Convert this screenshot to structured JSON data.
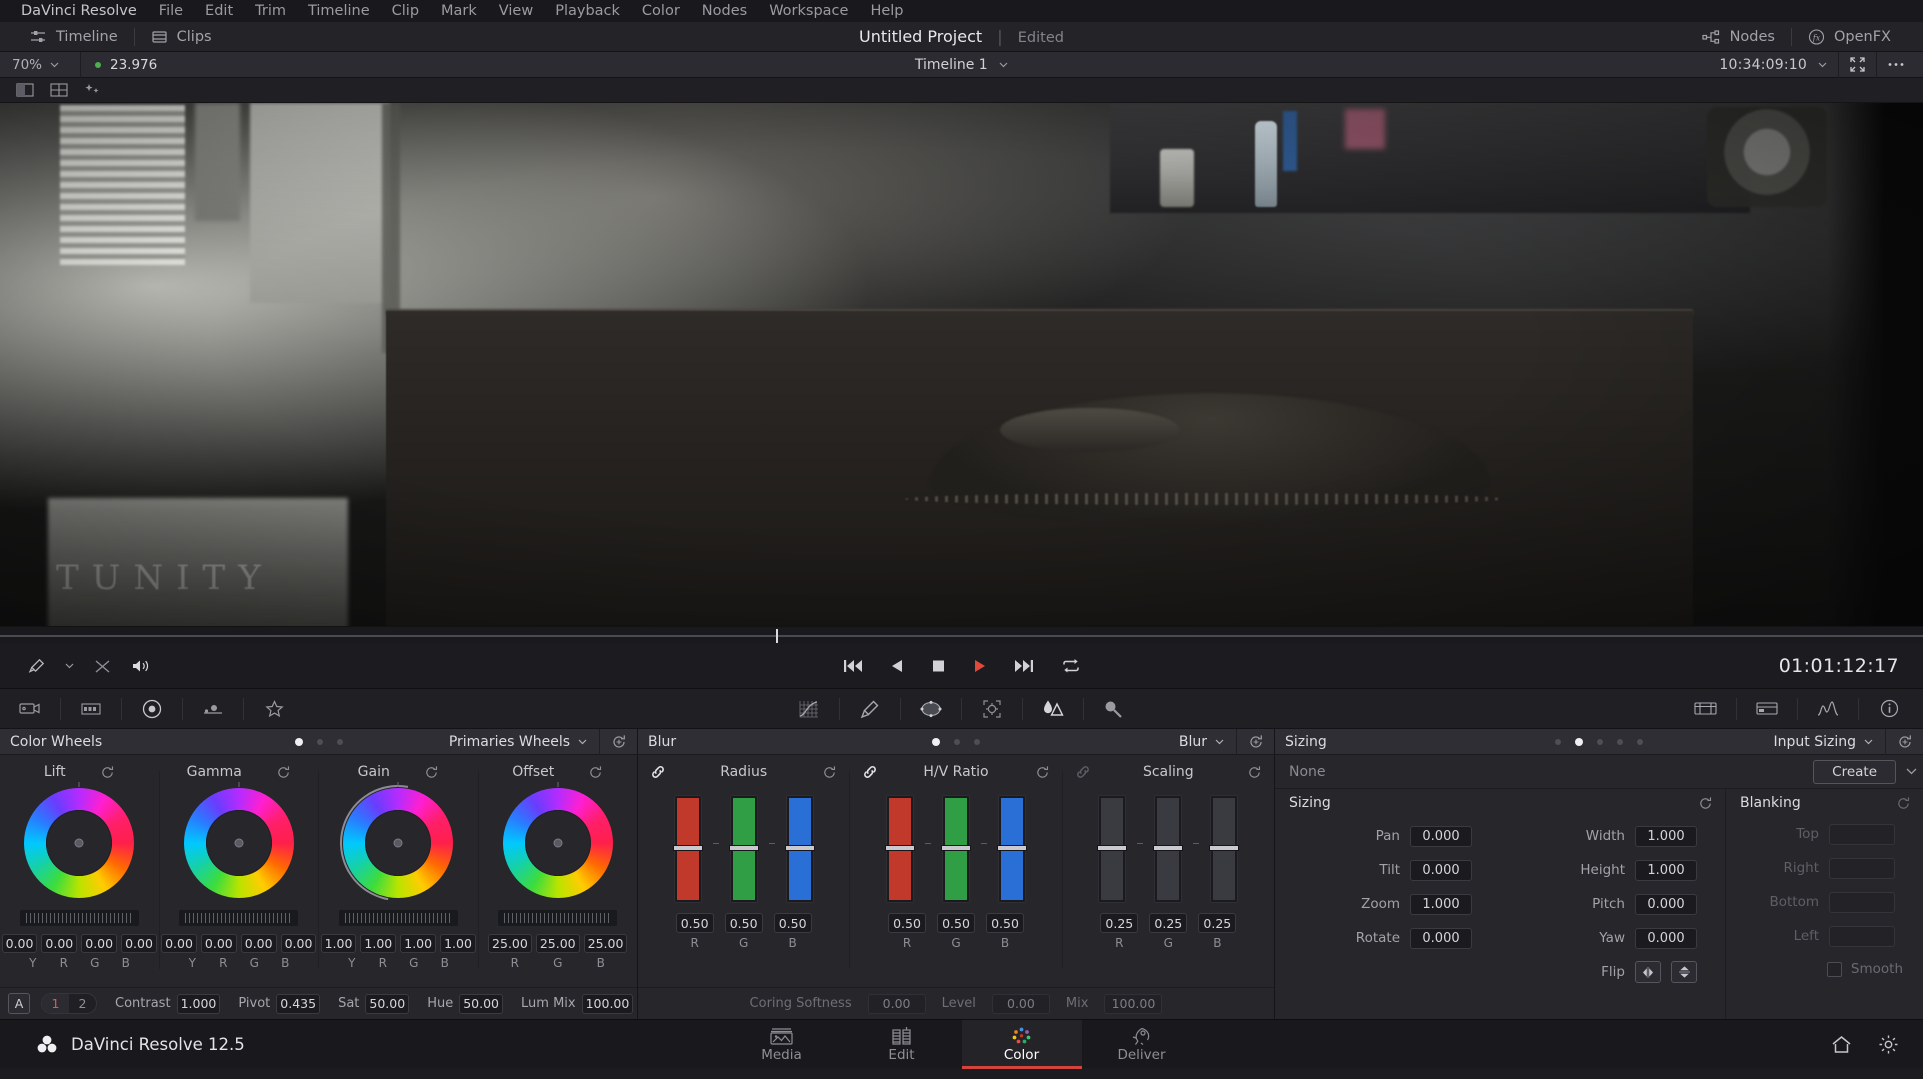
{
  "app": {
    "name": "DaVinci Resolve",
    "version_label": "DaVinci Resolve 12.5"
  },
  "menubar": {
    "items": [
      {
        "label": "DaVinci Resolve"
      },
      {
        "label": "File"
      },
      {
        "label": "Edit"
      },
      {
        "label": "Trim"
      },
      {
        "label": "Timeline"
      },
      {
        "label": "Clip"
      },
      {
        "label": "Mark"
      },
      {
        "label": "View"
      },
      {
        "label": "Playback"
      },
      {
        "label": "Color"
      },
      {
        "label": "Nodes"
      },
      {
        "label": "Workspace"
      },
      {
        "label": "Help"
      }
    ]
  },
  "titlebar": {
    "timeline_button": "Timeline",
    "clips_button": "Clips",
    "project_name": "Untitled Project",
    "separator": "|",
    "status": "Edited",
    "nodes_button": "Nodes",
    "openfx_button": "OpenFX"
  },
  "viewer_toolbar": {
    "zoom_level": "70%",
    "frame_rate": "23.976",
    "timeline_name": "Timeline 1",
    "timecode": "10:34:09:10"
  },
  "transport": {
    "timecode": "01:01:12:17",
    "buttons": [
      "jump-to-start",
      "reverse-play",
      "stop",
      "play",
      "jump-to-end",
      "loop"
    ]
  },
  "color_wheels": {
    "panel_title": "Color Wheels",
    "mode": "Primaries Wheels",
    "page_dots": 3,
    "active_dot": 0,
    "wheels": [
      {
        "name": "Lift",
        "channels": [
          "Y",
          "R",
          "G",
          "B"
        ],
        "values": [
          "0.00",
          "0.00",
          "0.00",
          "0.00"
        ]
      },
      {
        "name": "Gamma",
        "channels": [
          "Y",
          "R",
          "G",
          "B"
        ],
        "values": [
          "0.00",
          "0.00",
          "0.00",
          "0.00"
        ]
      },
      {
        "name": "Gain",
        "channels": [
          "Y",
          "R",
          "G",
          "B"
        ],
        "values": [
          "1.00",
          "1.00",
          "1.00",
          "1.00"
        ]
      },
      {
        "name": "Offset",
        "channels": [
          "R",
          "G",
          "B"
        ],
        "values": [
          "25.00",
          "25.00",
          "25.00"
        ]
      }
    ],
    "footer": {
      "scope_label": "A",
      "pages": [
        "1",
        "2"
      ],
      "active_page": "1",
      "controls": [
        {
          "label": "Contrast",
          "value": "1.000"
        },
        {
          "label": "Pivot",
          "value": "0.435"
        },
        {
          "label": "Sat",
          "value": "50.00"
        },
        {
          "label": "Hue",
          "value": "50.00"
        },
        {
          "label": "Lum Mix",
          "value": "100.00"
        }
      ]
    }
  },
  "blur": {
    "panel_title": "Blur",
    "mode": "Blur",
    "page_dots": 3,
    "active_dot": 0,
    "groups": [
      {
        "name": "Radius",
        "channels": [
          "R",
          "G",
          "B"
        ],
        "values": [
          "0.50",
          "0.50",
          "0.50"
        ],
        "linked": true
      },
      {
        "name": "H/V Ratio",
        "channels": [
          "R",
          "G",
          "B"
        ],
        "values": [
          "0.50",
          "0.50",
          "0.50"
        ],
        "linked": true
      },
      {
        "name": "Scaling",
        "channels": [
          "R",
          "G",
          "B"
        ],
        "values": [
          "0.25",
          "0.25",
          "0.25"
        ],
        "linked": false
      }
    ],
    "footer": [
      {
        "label": "Coring Softness",
        "value": "0.00"
      },
      {
        "label": "Level",
        "value": "0.00"
      },
      {
        "label": "Mix",
        "value": "100.00"
      }
    ]
  },
  "sizing": {
    "panel_title": "Sizing",
    "mode": "Input Sizing",
    "page_dots": 5,
    "active_dot": 1,
    "preset_value": "None",
    "create_button": "Create",
    "section_title": "Sizing",
    "left_fields": [
      {
        "label": "Pan",
        "value": "0.000"
      },
      {
        "label": "Tilt",
        "value": "0.000"
      },
      {
        "label": "Zoom",
        "value": "1.000"
      },
      {
        "label": "Rotate",
        "value": "0.000"
      }
    ],
    "right_fields": [
      {
        "label": "Width",
        "value": "1.000"
      },
      {
        "label": "Height",
        "value": "1.000"
      },
      {
        "label": "Pitch",
        "value": "0.000"
      },
      {
        "label": "Yaw",
        "value": "0.000"
      }
    ],
    "flip_label": "Flip",
    "blanking": {
      "title": "Blanking",
      "fields": [
        {
          "label": "Top",
          "value": ""
        },
        {
          "label": "Right",
          "value": ""
        },
        {
          "label": "Bottom",
          "value": ""
        },
        {
          "label": "Left",
          "value": ""
        }
      ],
      "smooth_label": "Smooth",
      "smooth_checked": false
    }
  },
  "bottombar": {
    "pages": [
      {
        "label": "Media",
        "icon": "media-icon",
        "active": false
      },
      {
        "label": "Edit",
        "icon": "edit-icon",
        "active": false
      },
      {
        "label": "Color",
        "icon": "color-icon",
        "active": true
      },
      {
        "label": "Deliver",
        "icon": "deliver-icon",
        "active": false
      }
    ]
  },
  "colors": {
    "accent_red": "#d3453c",
    "play_red": "#e04a3a",
    "panel_bg": "#26262b",
    "header_bg": "#2e2e34",
    "green_dot": "#4caf50"
  }
}
